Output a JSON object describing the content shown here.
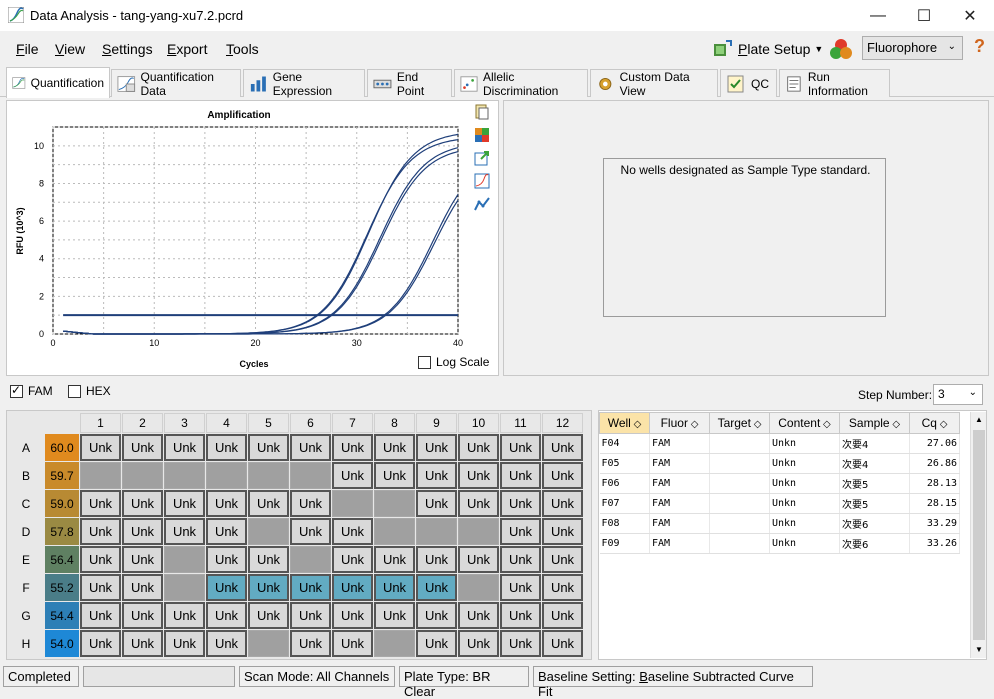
{
  "window": {
    "title": "Data Analysis - tang-yang-xu7.2.pcrd"
  },
  "menu": [
    {
      "label": "File",
      "u": "F",
      "rest": "ile"
    },
    {
      "label": "View",
      "u": "V",
      "rest": "iew"
    },
    {
      "label": "Settings",
      "u": "S",
      "rest": "ettings"
    },
    {
      "label": "Export",
      "u": "E",
      "rest": "xport"
    },
    {
      "label": "Tools",
      "u": "T",
      "rest": "ools"
    }
  ],
  "toolbar": {
    "plate_setup_u": "P",
    "plate_setup_rest": "late Setup",
    "fluorophore": "Fluorophore"
  },
  "tabs": [
    "Quantification",
    "Quantification Data",
    "Gene Expression",
    "End Point",
    "Allelic Discrimination",
    "Custom Data View",
    "QC",
    "Run Information"
  ],
  "chart_data": {
    "type": "line",
    "title": "Amplification",
    "xlabel": "Cycles",
    "ylabel": "RFU (10^3)",
    "xlim": [
      0,
      40
    ],
    "ylim": [
      0,
      11
    ],
    "xticks": [
      "0",
      "10",
      "20",
      "30",
      "40"
    ],
    "yticks": [
      "0",
      "2",
      "4",
      "6",
      "8",
      "10"
    ],
    "threshold": 1.0,
    "series": [
      {
        "well": "F04",
        "midpoint": 31.2,
        "max": 10.8
      },
      {
        "well": "F05",
        "midpoint": 31.0,
        "max": 10.5
      },
      {
        "well": "F06",
        "midpoint": 32.3,
        "max": 10.2
      },
      {
        "well": "F07",
        "midpoint": 32.4,
        "max": 10.0
      },
      {
        "well": "F08",
        "midpoint": 37.6,
        "max": 9.5
      },
      {
        "well": "F09",
        "midpoint": 37.5,
        "max": 9.8
      }
    ],
    "log_scale_label": "Log Scale"
  },
  "standard_message": "No wells designated as Sample Type standard.",
  "fluor_checks": [
    {
      "label": "FAM",
      "checked": true
    },
    {
      "label": "HEX",
      "checked": false
    }
  ],
  "step": {
    "label": "Step Number:",
    "value": "3"
  },
  "plate": {
    "columns": [
      "1",
      "2",
      "3",
      "4",
      "5",
      "6",
      "7",
      "8",
      "9",
      "10",
      "11",
      "12"
    ],
    "rows": [
      {
        "row": "A",
        "temp": "60.0",
        "color": "#e08a1e",
        "wells": [
          "u",
          "u",
          "u",
          "u",
          "u",
          "u",
          "u",
          "u",
          "u",
          "u",
          "u",
          "u"
        ]
      },
      {
        "row": "B",
        "temp": "59.7",
        "color": "#c98a2a",
        "wells": [
          "e",
          "e",
          "e",
          "e",
          "e",
          "e",
          "u",
          "u",
          "u",
          "u",
          "u",
          "u"
        ]
      },
      {
        "row": "C",
        "temp": "59.0",
        "color": "#b88a33",
        "wells": [
          "u",
          "u",
          "u",
          "u",
          "u",
          "u",
          "e",
          "e",
          "u",
          "u",
          "u",
          "u"
        ]
      },
      {
        "row": "D",
        "temp": "57.8",
        "color": "#9a8a43",
        "wells": [
          "u",
          "u",
          "u",
          "u",
          "e",
          "u",
          "u",
          "e",
          "e",
          "e",
          "u",
          "u"
        ]
      },
      {
        "row": "E",
        "temp": "56.4",
        "color": "#5f8062",
        "wells": [
          "u",
          "u",
          "e",
          "u",
          "u",
          "e",
          "u",
          "u",
          "u",
          "u",
          "u",
          "u"
        ]
      },
      {
        "row": "F",
        "temp": "55.2",
        "color": "#4a7d88",
        "wells": [
          "u",
          "u",
          "e",
          "s",
          "s",
          "s",
          "s",
          "s",
          "s",
          "e",
          "u",
          "u"
        ]
      },
      {
        "row": "G",
        "temp": "54.4",
        "color": "#2d7fb6",
        "wells": [
          "u",
          "u",
          "u",
          "u",
          "u",
          "u",
          "u",
          "u",
          "u",
          "u",
          "u",
          "u"
        ]
      },
      {
        "row": "H",
        "temp": "54.0",
        "color": "#1e88d6",
        "wells": [
          "u",
          "u",
          "u",
          "u",
          "e",
          "u",
          "u",
          "e",
          "u",
          "u",
          "u",
          "u"
        ]
      }
    ],
    "well_label": "Unk"
  },
  "data_table": {
    "headers": [
      "Well",
      "Fluor",
      "Target",
      "Content",
      "Sample",
      "Cq"
    ],
    "rows": [
      [
        "F04",
        "FAM",
        "",
        "Unkn",
        "次要4",
        "27.06"
      ],
      [
        "F05",
        "FAM",
        "",
        "Unkn",
        "次要4",
        "26.86"
      ],
      [
        "F06",
        "FAM",
        "",
        "Unkn",
        "次要5",
        "28.13"
      ],
      [
        "F07",
        "FAM",
        "",
        "Unkn",
        "次要5",
        "28.15"
      ],
      [
        "F08",
        "FAM",
        "",
        "Unkn",
        "次要6",
        "33.29"
      ],
      [
        "F09",
        "FAM",
        "",
        "Unkn",
        "次要6",
        "33.26"
      ]
    ]
  },
  "status": {
    "state": "Completed",
    "scan_mode": "Scan Mode: All Channels",
    "plate_type": "Plate Type: BR Clear",
    "baseline_prefix": "Baseline Setting: ",
    "baseline_u": "B",
    "baseline_rest": "aseline Subtracted Curve Fit"
  }
}
